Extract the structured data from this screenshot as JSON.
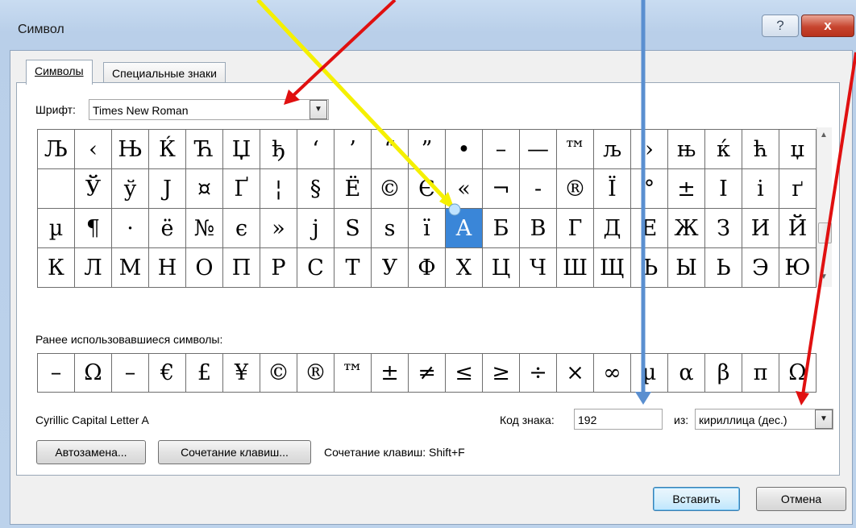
{
  "window": {
    "title": "Символ",
    "help_label": "?",
    "close_label": "x"
  },
  "tabs": [
    {
      "label": "Символы",
      "active": true
    },
    {
      "label": "Специальные знаки",
      "active": false
    }
  ],
  "font": {
    "label": "Шрифт:",
    "value": "Times New Roman"
  },
  "symbol_grid": {
    "rows": [
      [
        "Љ",
        "‹",
        "Њ",
        "Ќ",
        "Ћ",
        "Џ",
        "ђ",
        "‘",
        "’",
        "“",
        "”",
        "•",
        "–",
        "—",
        "™",
        "љ",
        "›",
        "њ",
        "ќ",
        "ћ",
        "џ"
      ],
      [
        "",
        "Ў",
        "ў",
        "Ј",
        "¤",
        "Ґ",
        "¦",
        "§",
        "Ё",
        "©",
        "Є",
        "«",
        "¬",
        "-",
        "®",
        "Ї",
        "°",
        "±",
        "І",
        "і",
        "ґ"
      ],
      [
        "µ",
        "¶",
        "·",
        "ё",
        "№",
        "є",
        "»",
        "ј",
        "Ѕ",
        "ѕ",
        "ї",
        "А",
        "Б",
        "В",
        "Г",
        "Д",
        "Е",
        "Ж",
        "З",
        "И",
        "Й"
      ],
      [
        "К",
        "Л",
        "М",
        "Н",
        "О",
        "П",
        "Р",
        "С",
        "Т",
        "У",
        "Ф",
        "Х",
        "Ц",
        "Ч",
        "Ш",
        "Щ",
        "Ъ",
        "Ы",
        "Ь",
        "Э",
        "Ю"
      ]
    ],
    "selected": "А"
  },
  "recent": {
    "label": "Ранее использовавшиеся символы:",
    "symbols": [
      "–",
      "Ω",
      "–",
      "€",
      "£",
      "¥",
      "©",
      "®",
      "™",
      "±",
      "≠",
      "≤",
      "≥",
      "÷",
      "×",
      "∞",
      "µ",
      "α",
      "β",
      "π",
      "Ω"
    ]
  },
  "char_name": "Cyrillic Capital Letter A",
  "code": {
    "label": "Код знака:",
    "value": "192"
  },
  "from": {
    "label": "из:",
    "value": "кириллица (дес.)"
  },
  "buttons": {
    "autocorrect": "Автозамена...",
    "shortcut_key": "Сочетание клавиш...",
    "insert": "Вставить",
    "cancel": "Отмена"
  },
  "shortcut_text": "Сочетание клавиш: Shift+F",
  "annotation_colors": {
    "yellow": "#f5f000",
    "red": "#e01010",
    "blue": "#5a8fd0"
  }
}
